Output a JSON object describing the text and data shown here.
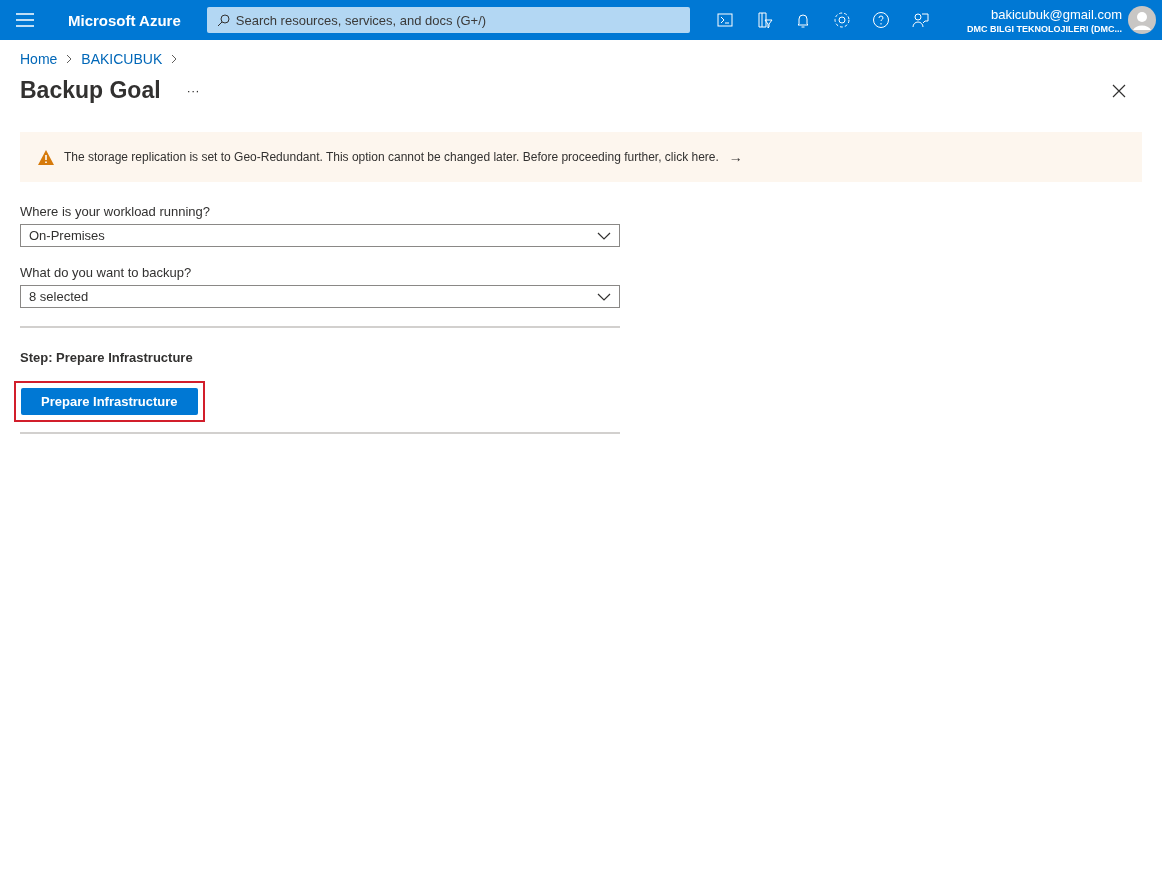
{
  "top_bar": {
    "brand": "Microsoft Azure",
    "search": {
      "placeholder": "Search resources, services, and docs (G+/)"
    },
    "account": {
      "email": "bakicubuk@gmail.com",
      "directory": "DMC BILGI TEKNOLOJILERI (DMC..."
    }
  },
  "breadcrumb": [
    "Home",
    "BAKICUBUK"
  ],
  "page": {
    "title": "Backup Goal",
    "more": "···"
  },
  "banner": {
    "kind": "warning",
    "text": "The storage replication is set to Geo-Redundant. This option cannot be changed later. Before proceeding further, click here.",
    "arrow": "→"
  },
  "fields": [
    {
      "label": "Where is your workload running?",
      "value": "On-Premises"
    },
    {
      "label": "What do you want to backup?",
      "value": "8 selected"
    }
  ],
  "step": {
    "title": "Step: Prepare Infrastructure",
    "button": {
      "label": "Prepare Infrastructure",
      "highlighted": true
    }
  }
}
